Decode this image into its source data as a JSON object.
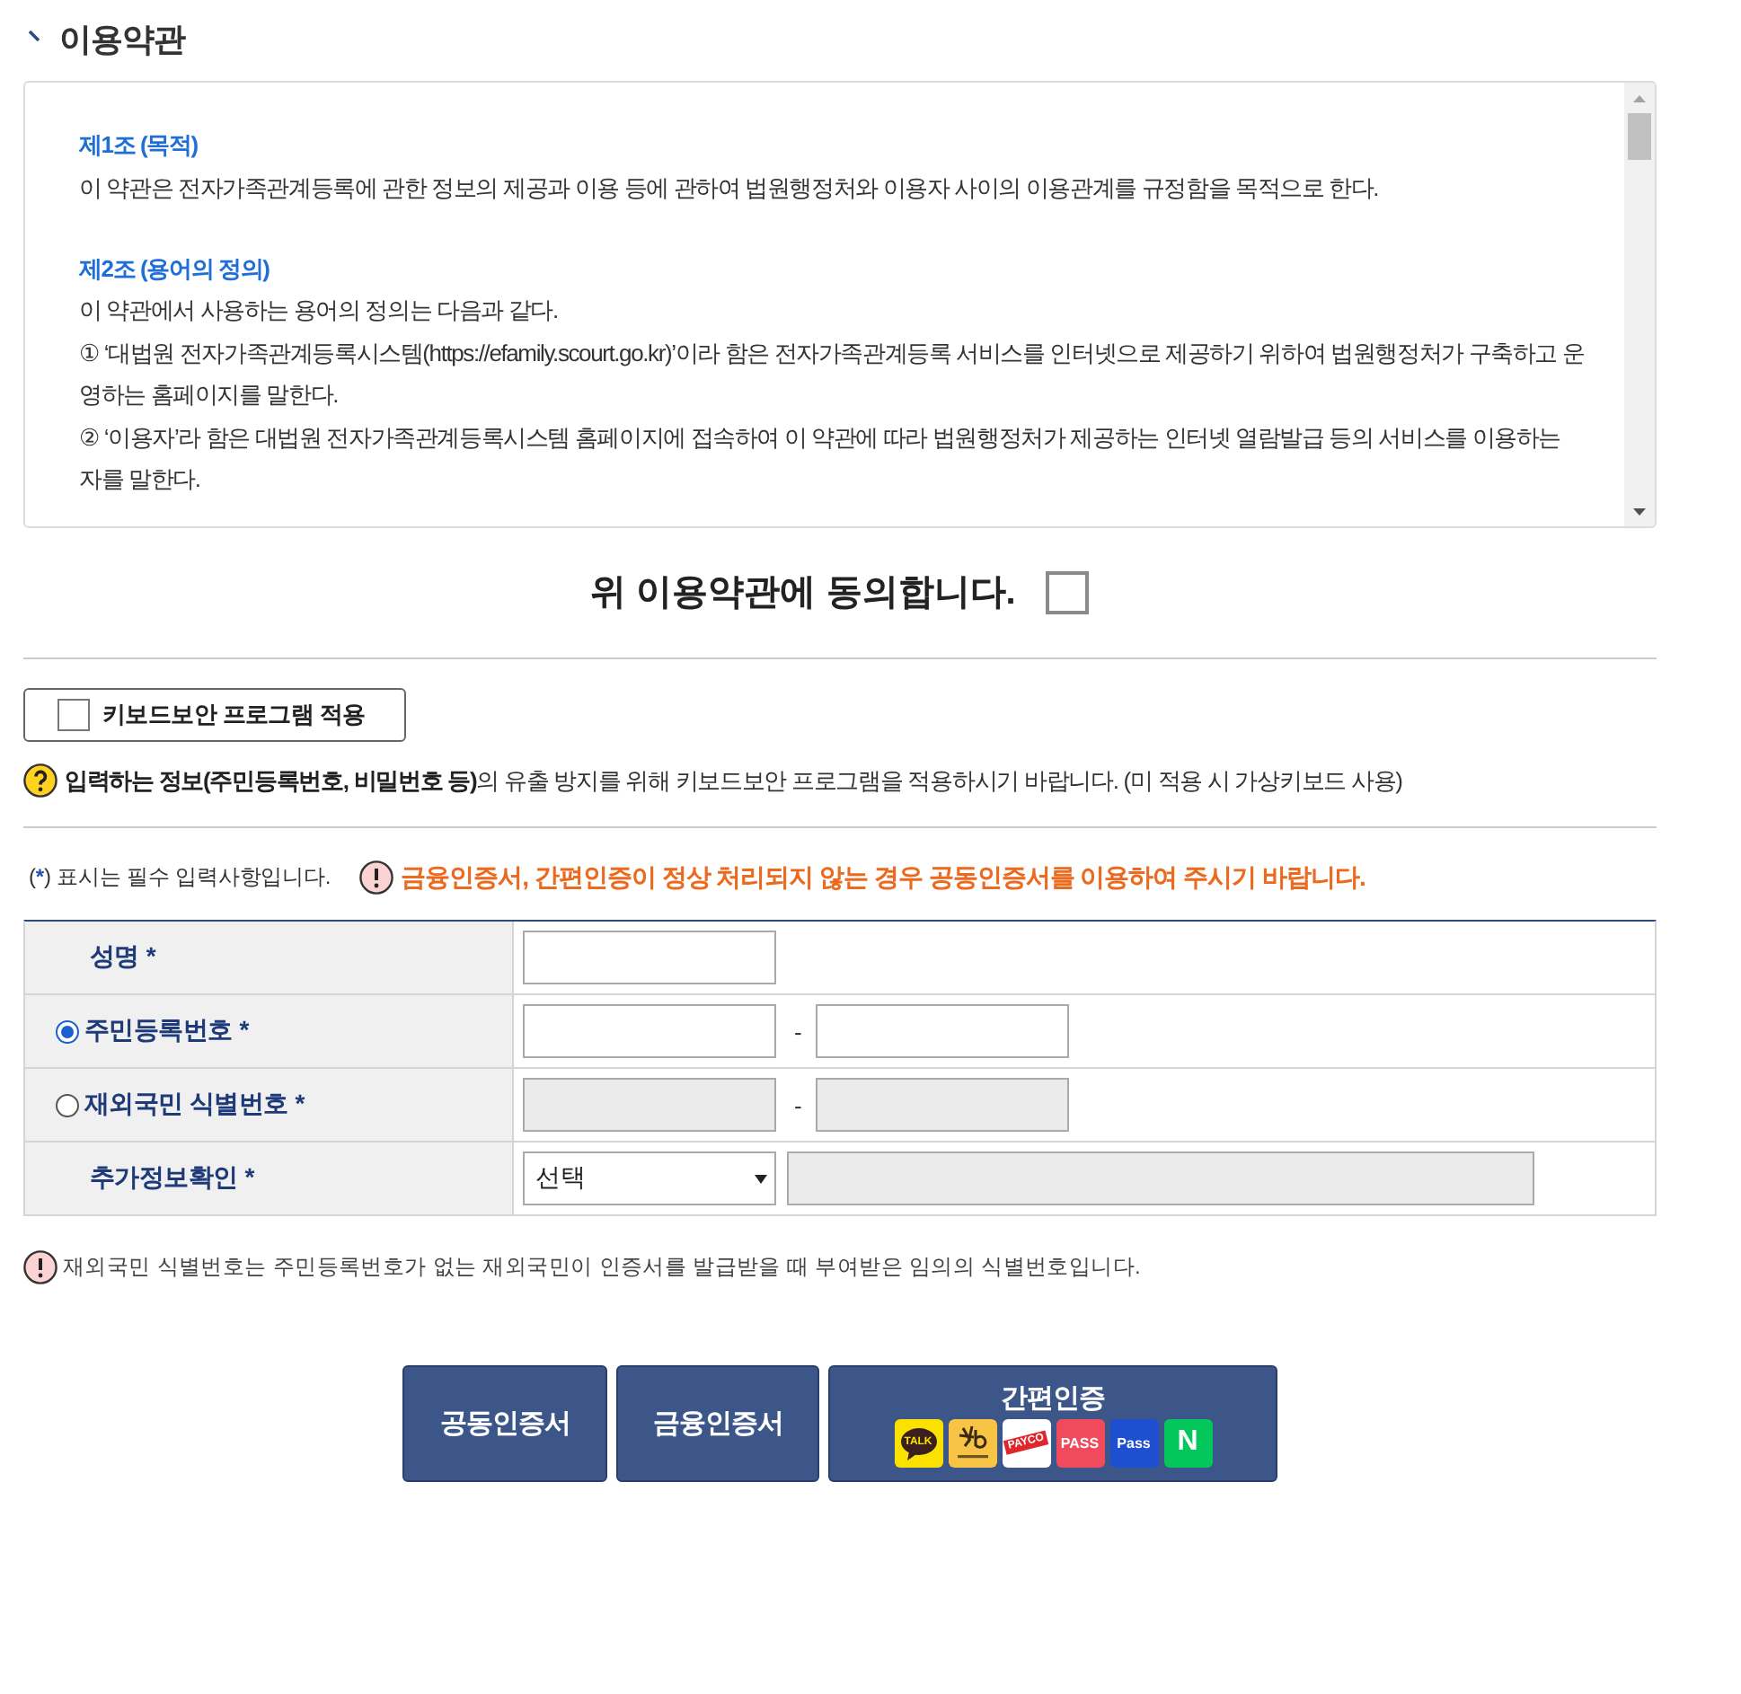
{
  "section_title": {
    "text": "이용약관"
  },
  "terms": {
    "articles": [
      {
        "heading": "제1조 (목적)",
        "paragraphs": [
          "이 약관은 전자가족관계등록에 관한 정보의 제공과 이용 등에 관하여 법원행정처와 이용자 사이의 이용관계를 규정함을 목적으로 한다."
        ]
      },
      {
        "heading": "제2조 (용어의 정의)",
        "paragraphs": [
          "이 약관에서 사용하는 용어의 정의는 다음과 같다.",
          "① ‘대법원 전자가족관계등록시스템(https://efamily.scourt.go.kr)’이라 함은 전자가족관계등록 서비스를 인터넷으로 제공하기 위하여 법원행정처가 구축하고 운영하는 홈페이지를 말한다.",
          "② ‘이용자’라 함은 대법원 전자가족관계등록시스템 홈페이지에 접속하여 이 약관에 따라 법원행정처가 제공하는 인터넷 열람발급 등의 서비스를 이용하는 자를 말한다."
        ]
      }
    ]
  },
  "agreement": {
    "label": "위 이용약관에 동의합니다.",
    "checked": false
  },
  "keyboard_security": {
    "label": "키보드보안 프로그램 적용",
    "checked": false
  },
  "keyboard_notice": "**입력하는 정보(주민등록번호, 비밀번호 등)**의 유출 방지를 위해 키보드보안 프로그램을 적용하시기 바랍니다. (미 적용 시 가상키보드 사용)",
  "required_note": {
    "before": "(",
    "mark": "*",
    "after": ") 표시는 필수 입력사항입니다."
  },
  "warning": "금융인증서, 간편인증이 정상 처리되지 않는 경우 공동인증서를 이용하여 주시기 바랍니다.",
  "form": {
    "rows": [
      {
        "kind": "text",
        "label": "성명",
        "mark": "*",
        "fields": [
          {
            "disabled": false
          }
        ]
      },
      {
        "kind": "radio",
        "label": "주민등록번호",
        "mark": "*",
        "selected": true,
        "separator": "-",
        "fields": [
          {
            "disabled": false
          },
          {
            "disabled": false
          }
        ]
      },
      {
        "kind": "radio",
        "label": "재외국민 식별번호",
        "mark": "*",
        "selected": false,
        "separator": "-",
        "fields": [
          {
            "disabled": true
          },
          {
            "disabled": true
          }
        ]
      },
      {
        "kind": "select",
        "label": "추가정보확인",
        "mark": "*",
        "select": {
          "value": "선택"
        },
        "fields": [
          {
            "disabled": true
          }
        ]
      }
    ]
  },
  "footnote": "재외국민 식별번호는 주민등록번호가 없는 재외국민이 인증서를 발급받을 때 부여받은 임의의 식별번호입니다.",
  "buttons": [
    {
      "kind": "plain",
      "label": "공동인증서"
    },
    {
      "kind": "plain",
      "label": "금융인증서"
    },
    {
      "kind": "simple",
      "label": "간편인증",
      "providers": [
        {
          "kind": "talk",
          "label": "TALK"
        },
        {
          "kind": "star"
        },
        {
          "kind": "banner",
          "label": "PAYCO"
        },
        {
          "kind": "pass",
          "label": "PASS"
        },
        {
          "kind": "blue_pass",
          "label": "Pass"
        },
        {
          "kind": "n",
          "label": "N"
        }
      ]
    }
  ]
}
